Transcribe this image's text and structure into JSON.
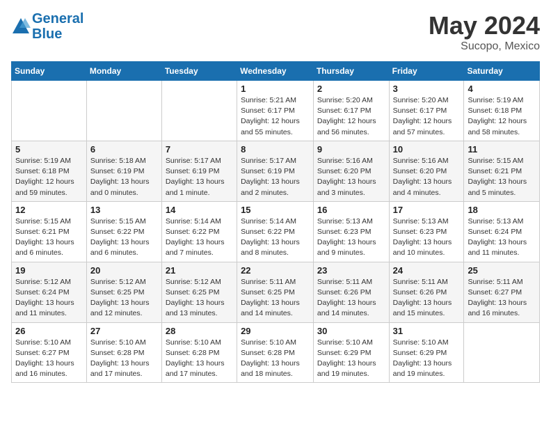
{
  "logo": {
    "line1": "General",
    "line2": "Blue"
  },
  "title": "May 2024",
  "subtitle": "Sucopo, Mexico",
  "days_header": [
    "Sunday",
    "Monday",
    "Tuesday",
    "Wednesday",
    "Thursday",
    "Friday",
    "Saturday"
  ],
  "weeks": [
    [
      {
        "day": "",
        "info": ""
      },
      {
        "day": "",
        "info": ""
      },
      {
        "day": "",
        "info": ""
      },
      {
        "day": "1",
        "info": "Sunrise: 5:21 AM\nSunset: 6:17 PM\nDaylight: 12 hours\nand 55 minutes."
      },
      {
        "day": "2",
        "info": "Sunrise: 5:20 AM\nSunset: 6:17 PM\nDaylight: 12 hours\nand 56 minutes."
      },
      {
        "day": "3",
        "info": "Sunrise: 5:20 AM\nSunset: 6:17 PM\nDaylight: 12 hours\nand 57 minutes."
      },
      {
        "day": "4",
        "info": "Sunrise: 5:19 AM\nSunset: 6:18 PM\nDaylight: 12 hours\nand 58 minutes."
      }
    ],
    [
      {
        "day": "5",
        "info": "Sunrise: 5:19 AM\nSunset: 6:18 PM\nDaylight: 12 hours\nand 59 minutes."
      },
      {
        "day": "6",
        "info": "Sunrise: 5:18 AM\nSunset: 6:19 PM\nDaylight: 13 hours\nand 0 minutes."
      },
      {
        "day": "7",
        "info": "Sunrise: 5:17 AM\nSunset: 6:19 PM\nDaylight: 13 hours\nand 1 minute."
      },
      {
        "day": "8",
        "info": "Sunrise: 5:17 AM\nSunset: 6:19 PM\nDaylight: 13 hours\nand 2 minutes."
      },
      {
        "day": "9",
        "info": "Sunrise: 5:16 AM\nSunset: 6:20 PM\nDaylight: 13 hours\nand 3 minutes."
      },
      {
        "day": "10",
        "info": "Sunrise: 5:16 AM\nSunset: 6:20 PM\nDaylight: 13 hours\nand 4 minutes."
      },
      {
        "day": "11",
        "info": "Sunrise: 5:15 AM\nSunset: 6:21 PM\nDaylight: 13 hours\nand 5 minutes."
      }
    ],
    [
      {
        "day": "12",
        "info": "Sunrise: 5:15 AM\nSunset: 6:21 PM\nDaylight: 13 hours\nand 6 minutes."
      },
      {
        "day": "13",
        "info": "Sunrise: 5:15 AM\nSunset: 6:22 PM\nDaylight: 13 hours\nand 6 minutes."
      },
      {
        "day": "14",
        "info": "Sunrise: 5:14 AM\nSunset: 6:22 PM\nDaylight: 13 hours\nand 7 minutes."
      },
      {
        "day": "15",
        "info": "Sunrise: 5:14 AM\nSunset: 6:22 PM\nDaylight: 13 hours\nand 8 minutes."
      },
      {
        "day": "16",
        "info": "Sunrise: 5:13 AM\nSunset: 6:23 PM\nDaylight: 13 hours\nand 9 minutes."
      },
      {
        "day": "17",
        "info": "Sunrise: 5:13 AM\nSunset: 6:23 PM\nDaylight: 13 hours\nand 10 minutes."
      },
      {
        "day": "18",
        "info": "Sunrise: 5:13 AM\nSunset: 6:24 PM\nDaylight: 13 hours\nand 11 minutes."
      }
    ],
    [
      {
        "day": "19",
        "info": "Sunrise: 5:12 AM\nSunset: 6:24 PM\nDaylight: 13 hours\nand 11 minutes."
      },
      {
        "day": "20",
        "info": "Sunrise: 5:12 AM\nSunset: 6:25 PM\nDaylight: 13 hours\nand 12 minutes."
      },
      {
        "day": "21",
        "info": "Sunrise: 5:12 AM\nSunset: 6:25 PM\nDaylight: 13 hours\nand 13 minutes."
      },
      {
        "day": "22",
        "info": "Sunrise: 5:11 AM\nSunset: 6:25 PM\nDaylight: 13 hours\nand 14 minutes."
      },
      {
        "day": "23",
        "info": "Sunrise: 5:11 AM\nSunset: 6:26 PM\nDaylight: 13 hours\nand 14 minutes."
      },
      {
        "day": "24",
        "info": "Sunrise: 5:11 AM\nSunset: 6:26 PM\nDaylight: 13 hours\nand 15 minutes."
      },
      {
        "day": "25",
        "info": "Sunrise: 5:11 AM\nSunset: 6:27 PM\nDaylight: 13 hours\nand 16 minutes."
      }
    ],
    [
      {
        "day": "26",
        "info": "Sunrise: 5:10 AM\nSunset: 6:27 PM\nDaylight: 13 hours\nand 16 minutes."
      },
      {
        "day": "27",
        "info": "Sunrise: 5:10 AM\nSunset: 6:28 PM\nDaylight: 13 hours\nand 17 minutes."
      },
      {
        "day": "28",
        "info": "Sunrise: 5:10 AM\nSunset: 6:28 PM\nDaylight: 13 hours\nand 17 minutes."
      },
      {
        "day": "29",
        "info": "Sunrise: 5:10 AM\nSunset: 6:28 PM\nDaylight: 13 hours\nand 18 minutes."
      },
      {
        "day": "30",
        "info": "Sunrise: 5:10 AM\nSunset: 6:29 PM\nDaylight: 13 hours\nand 19 minutes."
      },
      {
        "day": "31",
        "info": "Sunrise: 5:10 AM\nSunset: 6:29 PM\nDaylight: 13 hours\nand 19 minutes."
      },
      {
        "day": "",
        "info": ""
      }
    ]
  ]
}
